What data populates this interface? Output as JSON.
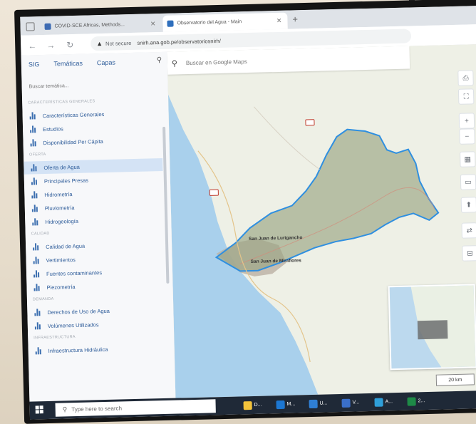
{
  "browser": {
    "tabs": [
      {
        "title": "COVID-SCE Africas, Methods...",
        "active": false
      },
      {
        "title": "Observatorio del Agua - Main",
        "active": true
      }
    ],
    "new_tab": "+",
    "address": {
      "security": "Not secure",
      "url": "snirh.ana.gob.pe/observatoriosnirh/"
    }
  },
  "sidebar": {
    "tabs": [
      "SIG",
      "Temáticas",
      "Capas"
    ],
    "search_placeholder": "Buscar temática...",
    "sections": [
      {
        "title": "CARACTERÍSTICAS GENERALES",
        "items": [
          "Características Generales",
          "Estudios",
          "Disponibilidad Per Cápita"
        ]
      },
      {
        "title": "OFERTA",
        "items": [
          "Oferta de Agua",
          "Principales Presas",
          "Hidrometría",
          "Pluviometría",
          "Hidrogeología"
        ]
      },
      {
        "title": "CALIDAD",
        "items": [
          "Calidad de Agua",
          "Vertimientos",
          "Fuentes contaminantes",
          "Piezometría"
        ]
      },
      {
        "title": "DEMANDA",
        "items": [
          "Derechos de Uso de Agua",
          "Volúmenes Utilizados"
        ]
      },
      {
        "title": "INFRAESTRUCTURA",
        "items": [
          "Infraestructura Hidráulica"
        ]
      }
    ],
    "selected_item": "Oferta de Agua"
  },
  "map": {
    "search_placeholder": "Buscar en Google Maps",
    "place_labels": [
      "San Juan de Lurigancho",
      "San Juan de Miraflores"
    ],
    "scale": "20 km",
    "colors": {
      "basin_fill": "#9aa583",
      "basin_stroke": "#2f8fe0",
      "sea": "#a9d0ec",
      "land": "#eef0e6"
    },
    "controls": [
      "print-icon",
      "fullscreen-icon",
      "zoom-in-icon",
      "zoom-out-icon",
      "layers-icon",
      "ruler-icon",
      "compass-icon",
      "share-icon",
      "save-icon"
    ]
  },
  "taskbar": {
    "search_placeholder": "Type here to search",
    "apps": [
      "D...",
      "M...",
      "U...",
      "V...",
      "A...",
      "2..."
    ]
  }
}
